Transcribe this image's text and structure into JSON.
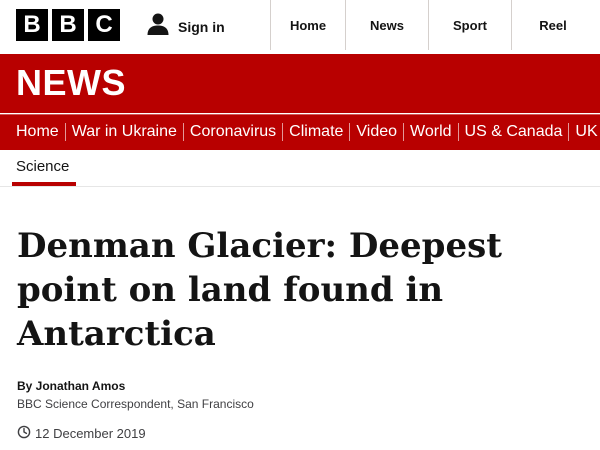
{
  "header": {
    "logo_letters": [
      "B",
      "B",
      "C"
    ],
    "signin_label": "Sign in",
    "nav": [
      "Home",
      "News",
      "Sport",
      "Reel"
    ]
  },
  "brand": {
    "title": "NEWS",
    "color": "#b80000"
  },
  "subnav": {
    "items": [
      "Home",
      "War in Ukraine",
      "Coronavirus",
      "Climate",
      "Video",
      "World",
      "US & Canada",
      "UK"
    ]
  },
  "section": {
    "label": "Science"
  },
  "article": {
    "headline": "Denman Glacier: Deepest point on land found in Antarctica",
    "author": "By Jonathan Amos",
    "role": "BBC Science Correspondent, San Francisco",
    "date": "12 December 2019"
  },
  "icons": {
    "user": "user-icon",
    "clock": "clock-icon"
  }
}
